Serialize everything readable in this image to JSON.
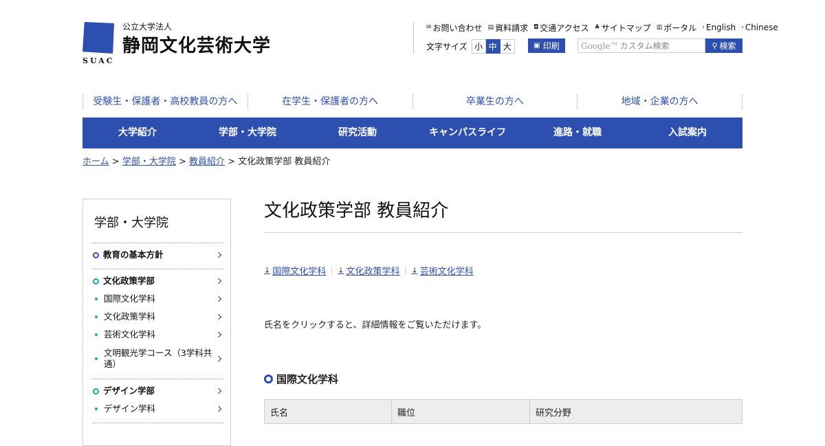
{
  "logo": {
    "sub": "公立大学法人",
    "name": "静岡文化芸術大学",
    "abbr": "SUAC"
  },
  "utility_links": [
    {
      "icon": "mail-icon",
      "glyph": "✉",
      "label": "お問い合わせ"
    },
    {
      "icon": "document-icon",
      "glyph": "▤",
      "label": "資料請求"
    },
    {
      "icon": "bus-icon",
      "glyph": "◘",
      "label": "交通アクセス"
    },
    {
      "icon": "sitemap-icon",
      "glyph": "♣",
      "label": "サイトマップ"
    },
    {
      "icon": "portal-icon",
      "glyph": "▥",
      "label": "ポータル"
    },
    {
      "icon": "chevron-right-icon",
      "glyph": "›",
      "label": "English"
    },
    {
      "icon": "chevron-right-icon",
      "glyph": "›",
      "label": "Chinese"
    }
  ],
  "font_size": {
    "label": "文字サイズ",
    "options": [
      "小",
      "中",
      "大"
    ],
    "selected": "中"
  },
  "print_label": "印刷",
  "search": {
    "google_mark": "Google™",
    "placeholder": "カスタム検索",
    "button": "検索"
  },
  "audience_nav": [
    "受験生・保護者・高校教員の方へ",
    "在学生・保護者の方へ",
    "卒業生の方へ",
    "地域・企業の方へ"
  ],
  "main_nav": [
    "大学紹介",
    "学部・大学院",
    "研究活動",
    "キャンパスライフ",
    "進路・就職",
    "入試案内"
  ],
  "breadcrumb": {
    "items": [
      "ホーム",
      "学部・大学院",
      "教員紹介"
    ],
    "current": "文化政策学部 教員紹介",
    "sep": ">"
  },
  "sidebar": {
    "title": "学部・大学院",
    "items": [
      {
        "label": "教育の基本方針",
        "level": "head"
      },
      {
        "label": "文化政策学部",
        "level": "head"
      },
      {
        "label": "国際文化学科",
        "level": "sub"
      },
      {
        "label": "文化政策学科",
        "level": "sub"
      },
      {
        "label": "芸術文化学科",
        "level": "sub"
      },
      {
        "label": "文明観光学コース（3学科共通）",
        "level": "sub"
      },
      {
        "label": "デザイン学部",
        "level": "head"
      },
      {
        "label": "デザイン学科",
        "level": "sub"
      }
    ]
  },
  "page_title": "文化政策学部  教員紹介",
  "anchors": [
    "国際文化学科",
    "文化政策学科",
    "芸術文化学科"
  ],
  "note": "氏名をクリックすると、詳細情報をご覧いただけます。",
  "section": {
    "title": "国際文化学科",
    "columns": [
      "氏名",
      "職位",
      "研究分野"
    ]
  },
  "colors": {
    "brand": "#2d4fb0",
    "accent": "#1aa5b5",
    "header_bg": "#ededed"
  }
}
